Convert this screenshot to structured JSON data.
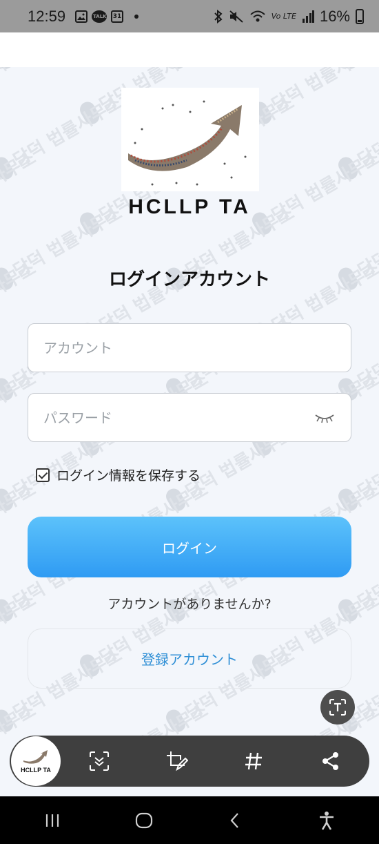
{
  "status_bar": {
    "time": "12:59",
    "notification_icons": [
      "gallery-icon",
      "talk-icon",
      "calendar-icon"
    ],
    "calendar_day": "31",
    "talk_label": "TALK",
    "network_label": "Vo LTE",
    "battery": "16%"
  },
  "app": {
    "brand": "HCLLP TA",
    "title": "ログインアカウント",
    "watermark_text": "담덕 법률사무소"
  },
  "form": {
    "account_placeholder": "アカウント",
    "password_placeholder": "パスワード",
    "remember_label": "ログイン情報を保存する",
    "remember_checked": true,
    "login_button": "ログイン",
    "no_account_text": "アカウントがありませんか?",
    "register_button": "登録アカウント"
  },
  "toolbar": {
    "thumbnail_label": "HCLLP TA",
    "tools": [
      "scan-text-icon",
      "edit-crop-icon",
      "hashtag-icon",
      "share-icon"
    ]
  },
  "colors": {
    "button_gradient_top": "#5cc2fb",
    "button_gradient_bottom": "#2f9bf3",
    "link": "#2f8fd6"
  }
}
